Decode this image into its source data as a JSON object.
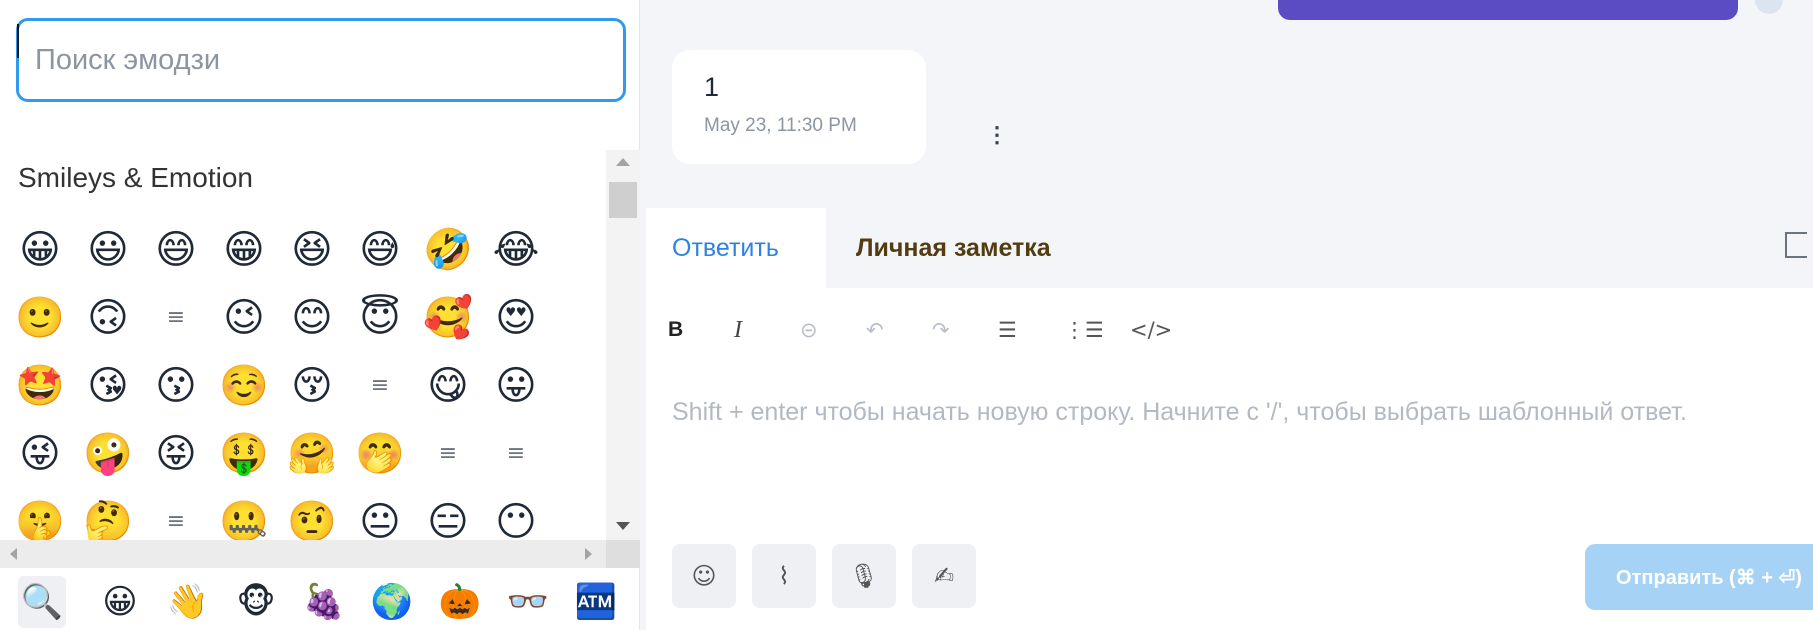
{
  "emoji_picker": {
    "search": {
      "placeholder": "Поиск эмодзи",
      "value": ""
    },
    "category_title": "Smileys & Emotion",
    "emojis": [
      "😀",
      "😃",
      "😄",
      "😁",
      "😆",
      "😅",
      "🤣",
      "😂",
      "🙂",
      "🙃",
      "≡",
      "😉",
      "😊",
      "😇",
      "🥰",
      "😍",
      "🤩",
      "😘",
      "😗",
      "☺️",
      "😚",
      "≡",
      "😋",
      "😛",
      "😜",
      "🤪",
      "😝",
      "🤑",
      "🤗",
      "🤭",
      "≡",
      "≡",
      "🤫",
      "🤔",
      "≡",
      "🤐",
      "🤨",
      "😐",
      "😑",
      "😶"
    ],
    "category_tabs": [
      {
        "icon": "search-icon",
        "glyph": "🔍"
      },
      {
        "icon": "smiley-icon",
        "glyph": "😀"
      },
      {
        "icon": "waving-hand-icon",
        "glyph": "👋"
      },
      {
        "icon": "monkey-icon",
        "glyph": "🐵"
      },
      {
        "icon": "grapes-icon",
        "glyph": "🍇"
      },
      {
        "icon": "globe-icon",
        "glyph": "🌍"
      },
      {
        "icon": "jack-o-lantern-icon",
        "glyph": "🎃"
      },
      {
        "icon": "glasses-icon",
        "glyph": "👓"
      },
      {
        "icon": "atm-icon",
        "glyph": "🏧"
      }
    ]
  },
  "message": {
    "text": "1",
    "time": "May 23, 11:30 PM",
    "menu_icon": "⋮"
  },
  "composer": {
    "tabs": {
      "reply": "Ответить",
      "private_note": "Личная заметка"
    },
    "toolbar": {
      "bold": "B",
      "italic": "I",
      "link": "⊝",
      "undo": "↶",
      "redo": "↷",
      "bullet_list": "☰",
      "ordered_list": "⋮☰",
      "code": "</>"
    },
    "placeholder": "Shift + enter чтобы начать новую строку. Начните с '/', чтобы выбрать шаблонный ответ.",
    "actions": {
      "emoji": "☺",
      "attach": "⌇",
      "mic": "🎙",
      "signature": "✍"
    },
    "send_label": "Отправить (⌘ + ⏎)"
  },
  "colors": {
    "accent": "#2f83e0",
    "search_border": "#2f9bea",
    "top_pill": "#5b4cc4",
    "send_button": "#a6d2f6",
    "note_tab_text": "#523d12"
  }
}
